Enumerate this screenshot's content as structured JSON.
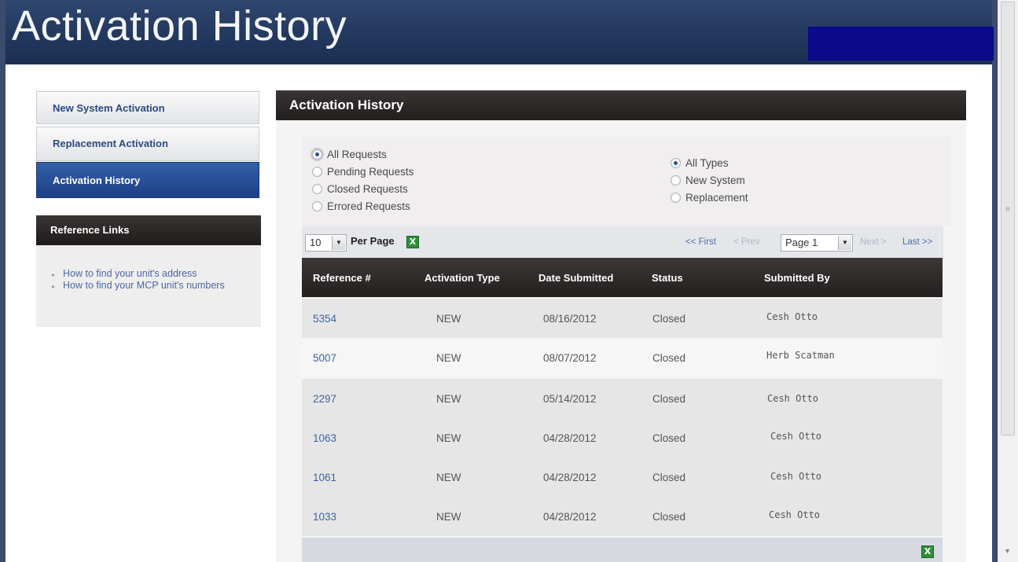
{
  "header": {
    "title": "Activation History"
  },
  "nav": {
    "items": [
      {
        "label": "New System Activation"
      },
      {
        "label": "Replacement Activation"
      },
      {
        "label": "Activation History"
      }
    ]
  },
  "reference": {
    "title": "Reference Links",
    "links": [
      {
        "label": "How to find your unit's address"
      },
      {
        "label": "How to find your MCP unit's numbers"
      }
    ]
  },
  "main": {
    "title": "Activation History",
    "request_filters": [
      {
        "label": "All Requests",
        "selected": true
      },
      {
        "label": "Pending Requests",
        "selected": false
      },
      {
        "label": "Closed Requests",
        "selected": false
      },
      {
        "label": "Errored Requests",
        "selected": false
      }
    ],
    "type_filters": [
      {
        "label": "All Types",
        "selected": true
      },
      {
        "label": "New System",
        "selected": false
      },
      {
        "label": "Replacement",
        "selected": false
      }
    ],
    "toolbar": {
      "per_page_value": "10",
      "per_page_label": "Per Page",
      "first": "<< First",
      "prev": "< Prev",
      "page_value": "Page 1",
      "next": "Next >",
      "last": "Last >>"
    },
    "table": {
      "columns": [
        "Reference #",
        "Activation Type",
        "Date Submitted",
        "Status",
        "Submitted By"
      ],
      "rows": [
        {
          "ref": "5354",
          "type": "NEW",
          "date": "08/16/2012",
          "status": "Closed",
          "by": "Cesh Otto"
        },
        {
          "ref": "5007",
          "type": "NEW",
          "date": "08/07/2012",
          "status": "Closed",
          "by": "Herb Scatman"
        },
        {
          "ref": "2297",
          "type": "NEW",
          "date": "05/14/2012",
          "status": "Closed",
          "by": "Cesh Otto"
        },
        {
          "ref": "1063",
          "type": "NEW",
          "date": "04/28/2012",
          "status": "Closed",
          "by": "Cesh Otto"
        },
        {
          "ref": "1061",
          "type": "NEW",
          "date": "04/28/2012",
          "status": "Closed",
          "by": "Cesh Otto"
        },
        {
          "ref": "1033",
          "type": "NEW",
          "date": "04/28/2012",
          "status": "Closed",
          "by": "Cesh Otto"
        }
      ]
    }
  },
  "colors": {
    "header_bg": "#22375c",
    "nav_active": "#1d3f86",
    "dark_bar": "#2a2525",
    "link": "#3d65a8",
    "row_alt": "#e6e6e6",
    "row_light": "#f6f6f6"
  }
}
